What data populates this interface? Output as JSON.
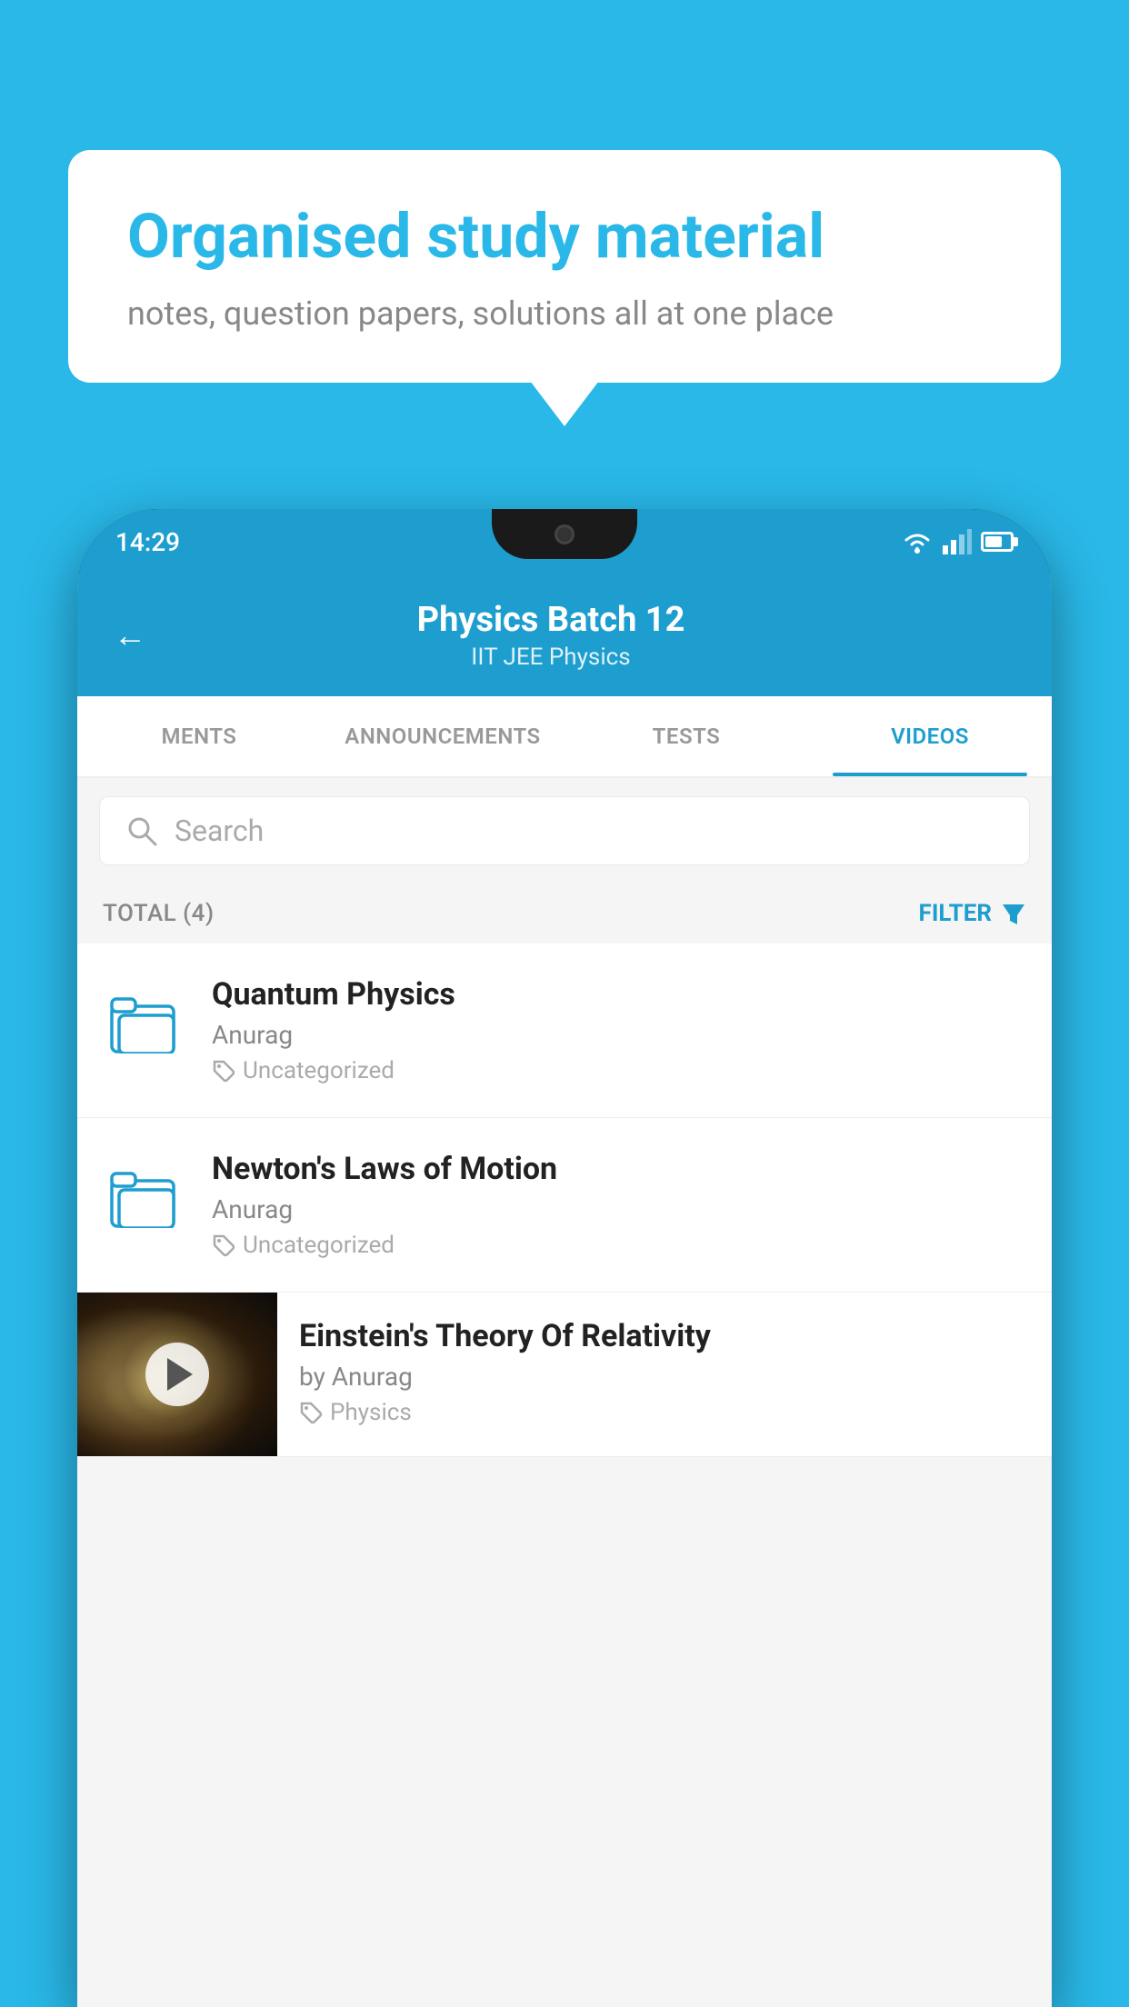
{
  "background_color": "#29b8e8",
  "speech_bubble": {
    "title": "Organised study material",
    "subtitle": "notes, question papers, solutions all at one place"
  },
  "phone": {
    "status_bar": {
      "time": "14:29"
    },
    "app_header": {
      "title": "Physics Batch 12",
      "subtitle_1": "IIT JEE",
      "subtitle_2": "Physics",
      "back_label": "←"
    },
    "tabs": [
      {
        "label": "MENTS",
        "active": false
      },
      {
        "label": "ANNOUNCEMENTS",
        "active": false
      },
      {
        "label": "TESTS",
        "active": false
      },
      {
        "label": "VIDEOS",
        "active": true
      }
    ],
    "search": {
      "placeholder": "Search"
    },
    "filter_bar": {
      "total_label": "TOTAL (4)",
      "filter_label": "FILTER"
    },
    "items": [
      {
        "type": "folder",
        "title": "Quantum Physics",
        "author": "Anurag",
        "tag": "Uncategorized"
      },
      {
        "type": "folder",
        "title": "Newton's Laws of Motion",
        "author": "Anurag",
        "tag": "Uncategorized"
      },
      {
        "type": "video",
        "title": "Einstein's Theory Of Relativity",
        "author": "by Anurag",
        "tag": "Physics"
      }
    ]
  }
}
